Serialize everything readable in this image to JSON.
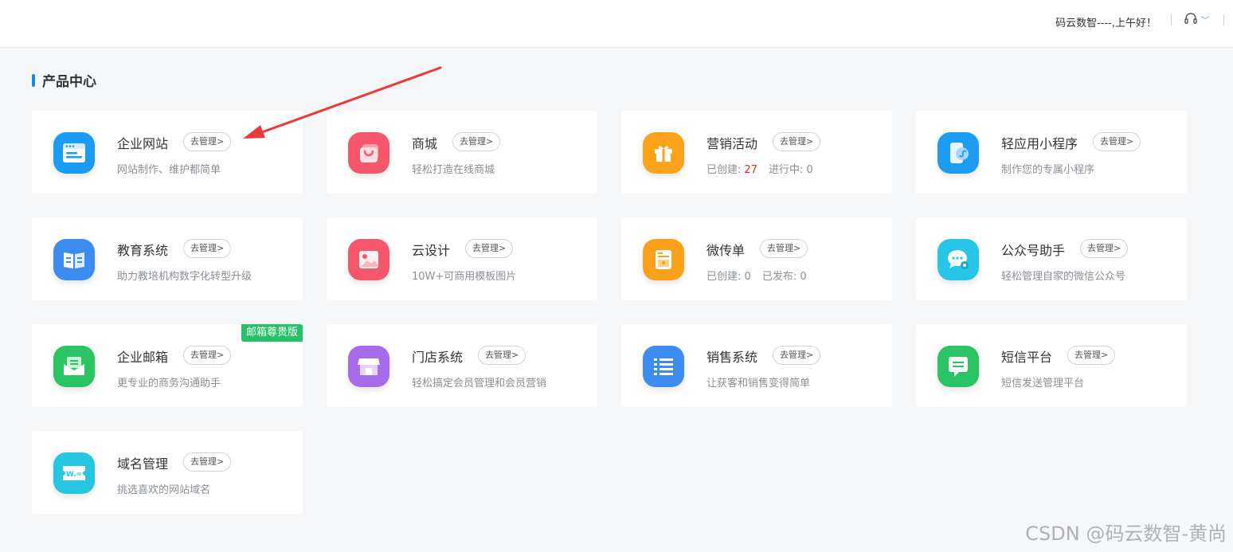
{
  "header": {
    "greeting": "码云数智----,上午好！",
    "support_icon": "headset-icon"
  },
  "section": {
    "title": "产品中心"
  },
  "manage_label": "去管理>",
  "cards": [
    {
      "name": "企业网站",
      "desc": "网站制作、维护都简单",
      "icon": "browser-window-icon",
      "color": "#1a9cf6"
    },
    {
      "name": "商城",
      "desc": "轻松打造在线商城",
      "icon": "shopping-bag-icon",
      "color": "#f4566c"
    },
    {
      "name": "营销活动",
      "desc_parts": {
        "created_label": "已创建:",
        "created_value": "27",
        "progress_label": "进行中:",
        "progress_value": "0"
      },
      "icon": "gift-icon",
      "color": "#fba31a"
    },
    {
      "name": "轻应用小程序",
      "desc": "制作您的专属小程序",
      "icon": "mini-program-icon",
      "color": "#1d9cf4"
    },
    {
      "name": "教育系统",
      "desc": "助力教培机构数字化转型升级",
      "icon": "book-icon",
      "color": "#3d8cf0"
    },
    {
      "name": "云设计",
      "desc": "10W+可商用模板图片",
      "icon": "image-icon",
      "color": "#f4566c"
    },
    {
      "name": "微传单",
      "desc_parts": {
        "created_label": "已创建:",
        "created_value": "0",
        "published_label": "已发布:",
        "published_value": "0"
      },
      "icon": "flyer-icon",
      "color": "#f9a11b"
    },
    {
      "name": "公众号助手",
      "desc": "轻松管理自家的微信公众号",
      "icon": "wechat-icon",
      "color": "#29c5e8"
    },
    {
      "name": "企业邮箱",
      "desc": "更专业的商务沟通助手",
      "icon": "mail-icon",
      "color": "#2ac465",
      "badge": "邮箱尊贵版"
    },
    {
      "name": "门店系统",
      "desc": "轻松搞定会员管理和会员营销",
      "icon": "store-icon",
      "color": "#a66be8"
    },
    {
      "name": "销售系统",
      "desc": "让获客和销售变得简单",
      "icon": "list-icon",
      "color": "#3d8cf0"
    },
    {
      "name": "短信平台",
      "desc": "短信发送管理平台",
      "icon": "message-icon",
      "color": "#2ac465"
    },
    {
      "name": "域名管理",
      "desc": "挑选喜欢的网站域名",
      "icon": "domain-ticket-icon",
      "color": "#26c6e0",
      "icon_text": "W.="
    }
  ],
  "watermark": "CSDN @码云数智-黄尚"
}
